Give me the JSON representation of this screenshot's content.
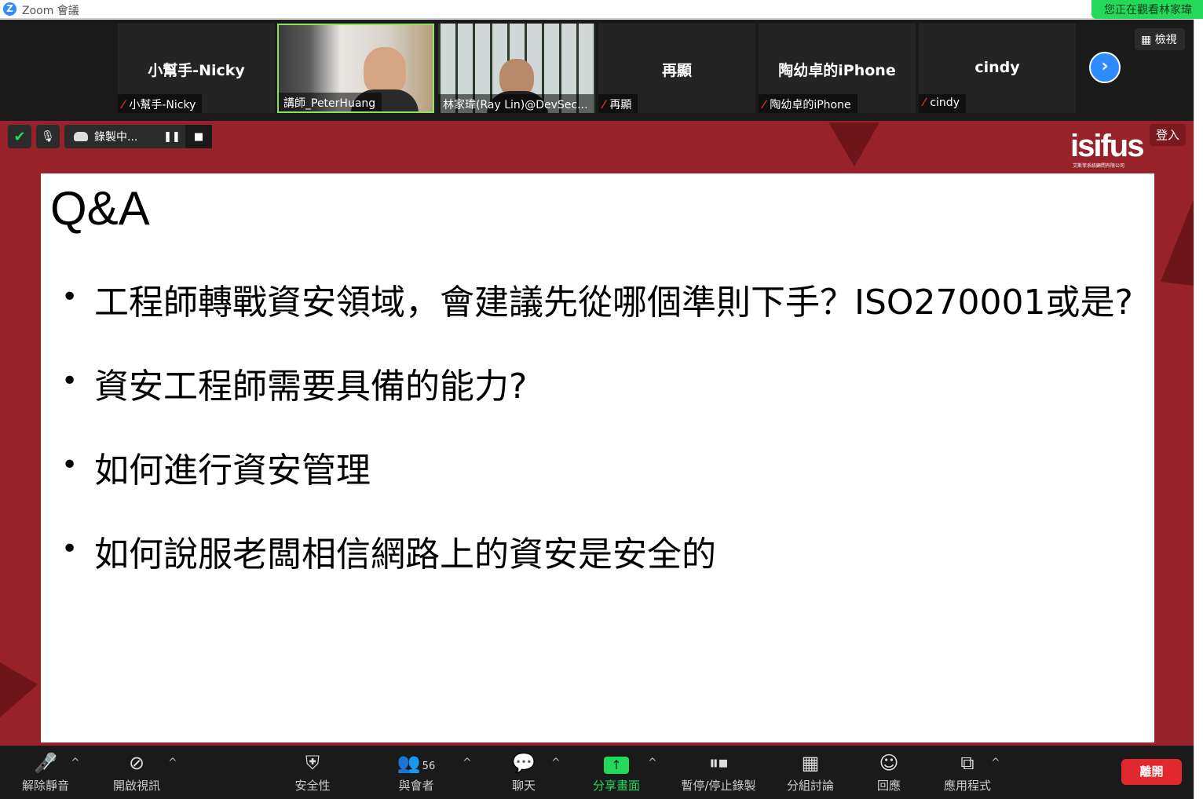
{
  "titlebar": {
    "logo": "Z",
    "title": "Zoom 會議",
    "viewing_banner": "您正在觀看林家瑋"
  },
  "participants": [
    {
      "big_name": "小幫手-Nicky",
      "label": "小幫手-Nicky",
      "muted": true,
      "video": false
    },
    {
      "big_name": "",
      "label": "講師_PeterHuang",
      "muted": false,
      "video": true
    },
    {
      "big_name": "",
      "label": "林家瑋(Ray Lin)@DevSec...",
      "muted": false,
      "video": true
    },
    {
      "big_name": "再顯",
      "label": "再顯",
      "muted": true,
      "video": false
    },
    {
      "big_name": "陶幼卓的iPhone",
      "label": "陶幼卓的iPhone",
      "muted": true,
      "video": false
    },
    {
      "big_name": "cindy",
      "label": "cindy",
      "muted": true,
      "video": false
    }
  ],
  "strip": {
    "next_icon": "chevron-right-icon",
    "view_label": "檢視"
  },
  "recording": {
    "label": "錄製中..."
  },
  "signin_label": "登入",
  "logo": {
    "text": "isifus",
    "sub": "艾斯菲系統顧問有限公司"
  },
  "slide": {
    "title": "Q&A",
    "bullets": [
      "工程師轉戰資安領域，會建議先從哪個準則下手？ISO270001或是?",
      "資安工程師需要具備的能力?",
      "如何進行資安管理",
      "如何說服老闆相信網路上的資安是安全的"
    ]
  },
  "toolbar": {
    "unmute": "解除靜音",
    "start_video": "開啟視訊",
    "security": "安全性",
    "participants": "與會者",
    "participants_count": "56",
    "chat": "聊天",
    "share_screen": "分享畫面",
    "pause_stop_recording": "暫停/停止錄製",
    "breakout": "分組討論",
    "reactions": "回應",
    "apps": "應用程式",
    "leave": "離開"
  },
  "colors": {
    "share_bg": "#97222a",
    "accent_blue": "#2d8cff",
    "green": "#23d959",
    "leave_red": "#e0282e"
  }
}
